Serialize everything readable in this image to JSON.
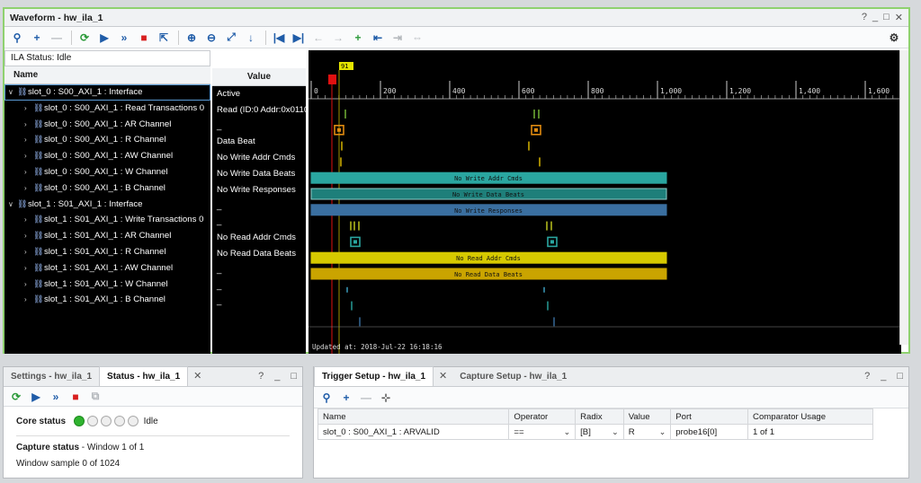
{
  "waveform": {
    "title": "Waveform - hw_ila_1",
    "window_controls": [
      "?",
      "_",
      "□",
      "✕"
    ],
    "ila_status": "ILA Status: Idle",
    "name_header": "Name",
    "value_header": "Value",
    "cursor_marker": "91",
    "updated_text": "Updated at: 2018-Jul-22 16:18:16",
    "rows": [
      {
        "name": "slot_0 : S00_AXI_1 : Interface",
        "value": "Active",
        "level": 0,
        "expanded": true
      },
      {
        "name": "slot_0 : S00_AXI_1 : Read Transactions 0",
        "value": "Read (ID:0 Addr:0x0110",
        "level": 1,
        "expanded": false
      },
      {
        "name": "slot_0 : S00_AXI_1 : AR Channel",
        "value": "_",
        "level": 1,
        "expanded": false
      },
      {
        "name": "slot_0 : S00_AXI_1 : R Channel",
        "value": "Data Beat",
        "level": 1,
        "expanded": false
      },
      {
        "name": "slot_0 : S00_AXI_1 : AW Channel",
        "value": "No Write Addr Cmds",
        "level": 1,
        "expanded": false
      },
      {
        "name": "slot_0 : S00_AXI_1 : W Channel",
        "value": "No Write Data Beats",
        "level": 1,
        "expanded": false
      },
      {
        "name": "slot_0 : S00_AXI_1 : B Channel",
        "value": "No Write Responses",
        "level": 1,
        "expanded": false
      },
      {
        "name": "slot_1 : S01_AXI_1 : Interface",
        "value": "_",
        "level": 0,
        "expanded": true
      },
      {
        "name": "slot_1 : S01_AXI_1 : Write Transactions 0",
        "value": "_",
        "level": 1,
        "expanded": false
      },
      {
        "name": "slot_1 : S01_AXI_1 : AR Channel",
        "value": "No Read Addr Cmds",
        "level": 1,
        "expanded": false
      },
      {
        "name": "slot_1 : S01_AXI_1 : R Channel",
        "value": "No Read Data Beats",
        "level": 1,
        "expanded": false
      },
      {
        "name": "slot_1 : S01_AXI_1 : AW Channel",
        "value": "_",
        "level": 1,
        "expanded": false
      },
      {
        "name": "slot_1 : S01_AXI_1 : W Channel",
        "value": "_",
        "level": 1,
        "expanded": false
      },
      {
        "name": "slot_1 : S01_AXI_1 : B Channel",
        "value": "_",
        "level": 1,
        "expanded": false
      }
    ],
    "ruler_ticks": [
      "0",
      "200",
      "400",
      "600",
      "800",
      "1,000",
      "1,200",
      "1,400",
      "1,600"
    ],
    "bus_labels": {
      "aw": "No Write Addr Cmds",
      "w": "No Write Data Beats",
      "b": "No Write Responses",
      "ar": "No Read Addr Cmds",
      "r": "No Read Data Beats"
    },
    "colors": {
      "teal": "#2aa6a0",
      "blue": "#3a6fa0",
      "yellow": "#d6c900",
      "marker_red": "#e01010",
      "orange": "#e08a10"
    }
  },
  "settings_panel": {
    "tab1": "Settings - hw_ila_1",
    "tab2": "Status - hw_ila_1",
    "core_status_label": "Core status",
    "core_status_value": "Idle",
    "capture_status_label": "Capture status",
    "capture_status_value": "Window 1 of 1",
    "window_sample": "Window sample 0 of 1024"
  },
  "trigger_panel": {
    "tab1": "Trigger Setup - hw_ila_1",
    "tab2": "Capture Setup - hw_ila_1",
    "columns": [
      "Name",
      "Operator",
      "Radix",
      "Value",
      "Port",
      "Comparator Usage"
    ],
    "row": {
      "name": "slot_0 : S00_AXI_1 : ARVALID",
      "operator": "==",
      "radix": "[B]",
      "value": "R",
      "port": "probe16[0]",
      "usage": "1 of 1"
    }
  }
}
